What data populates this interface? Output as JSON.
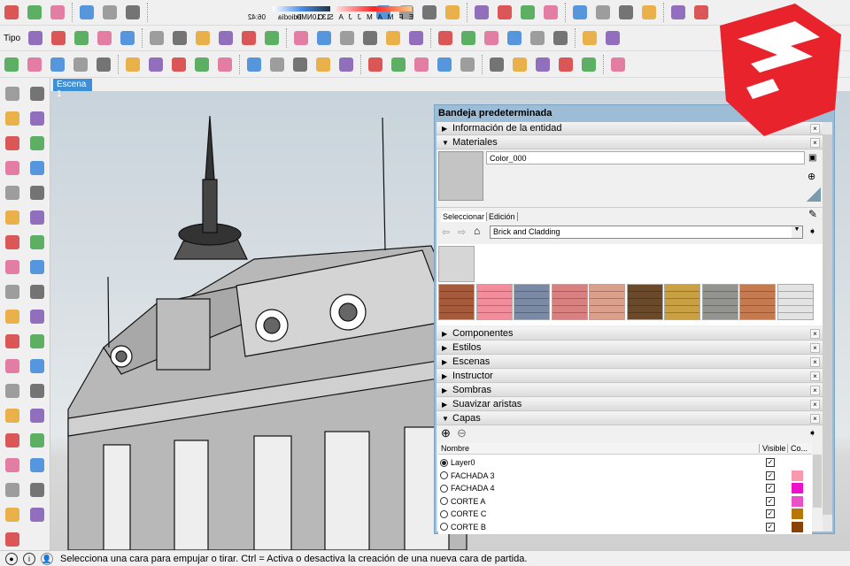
{
  "toolbars": {
    "row1": [
      "warehouse",
      "share-model",
      "extension",
      "get-models",
      "share-component",
      "upload-model",
      "ruby-console",
      "gear",
      "shadow-settings",
      "time-slider",
      "date-slider",
      "box-tool",
      "info",
      "printer",
      "undo",
      "redo",
      "delete",
      "paste",
      "cut",
      "copy",
      "save",
      "import",
      "open",
      "new",
      "export",
      "print-preview"
    ],
    "row2": [
      "tipo",
      "home",
      "front-view",
      "back-view",
      "left-view",
      "right-view",
      "iso-view",
      "top-view",
      "zoom-extents",
      "zoom",
      "pan",
      "orbit",
      "walk",
      "text",
      "axes",
      "push-pull",
      "rotate",
      "move",
      "arc",
      "paint-bucket",
      "dropdown",
      "rectangle",
      "circle",
      "pencil",
      "eraser",
      "select"
    ],
    "row3": [
      "dimension",
      "protractor",
      "tape-measure",
      "section-plane",
      "axes",
      "text-3d",
      "follow-me",
      "scale",
      "rotate",
      "offset",
      "push-pull",
      "move",
      "arc",
      "2-point-arc",
      "3-point-arc",
      "pie",
      "circle",
      "polygon",
      "freehand",
      "line",
      "eraser",
      "paint",
      "component",
      "position-camera",
      "look-around",
      "walk"
    ]
  },
  "shadow": {
    "time_start": "13:10",
    "noon": "Mediodía",
    "time_end": "06:42",
    "months": "E F M A M J J A S O N D"
  },
  "tipo_label": "Tipo",
  "left_tools": [
    "select",
    "arrow",
    "eraser",
    "paint-bucket",
    "arc",
    "pencil",
    "rectangle",
    "rotated-rectangle",
    "circle",
    "polygon",
    "arc-2",
    "pie",
    "3-point-arc",
    "2-point-arc",
    "push-pull",
    "move",
    "follow-me",
    "rotate",
    "offset",
    "scale",
    "tape-measure",
    "dimension",
    "text",
    "protractor",
    "3d-text",
    "axes",
    "orbit",
    "pan",
    "zoom",
    "zoom-window",
    "zoom-extents",
    "previous-view",
    "section-plane",
    "walk",
    "look-around",
    "position-camera",
    "footprints"
  ],
  "scene_tab": "Escena 1",
  "panel": {
    "title": "Bandeja predeterminada",
    "sections_top": [
      {
        "label": "Información de la entidad",
        "open": false
      },
      {
        "label": "Materiales",
        "open": true
      }
    ],
    "material_name": "Color_000",
    "tabs": [
      "Seleccionar",
      "Edición"
    ],
    "library": "Brick and Cladding",
    "swatch_colors": [
      "#a55a3c",
      "#f28d9c",
      "#7b8aa4",
      "#d98080",
      "#dba08c",
      "#6b4a2b",
      "#caa044",
      "#93938f",
      "#c57a50",
      "#e3e3e3"
    ],
    "sections_mid": [
      "Componentes",
      "Estilos",
      "Escenas",
      "Instructor",
      "Sombras",
      "Suavizar aristas",
      "Capas"
    ],
    "layers_headers": {
      "name": "Nombre",
      "visible": "Visible",
      "color": "Co..."
    },
    "layers": [
      {
        "name": "Layer0",
        "active": true,
        "visible": true,
        "color": ""
      },
      {
        "name": "FACHADA 3",
        "active": false,
        "visible": true,
        "color": "#f79ab0"
      },
      {
        "name": "FACHADA 4",
        "active": false,
        "visible": true,
        "color": "#ec10c8"
      },
      {
        "name": "CORTE A",
        "active": false,
        "visible": true,
        "color": "#ea50c8"
      },
      {
        "name": "CORTE C",
        "active": false,
        "visible": true,
        "color": "#b87508"
      },
      {
        "name": "CORTE B",
        "active": false,
        "visible": true,
        "color": "#8a4204"
      }
    ]
  },
  "status": {
    "text": "Selecciona una cara para empujar o tirar. Ctrl = Activa o desactiva la creación de una nueva cara de partida."
  }
}
